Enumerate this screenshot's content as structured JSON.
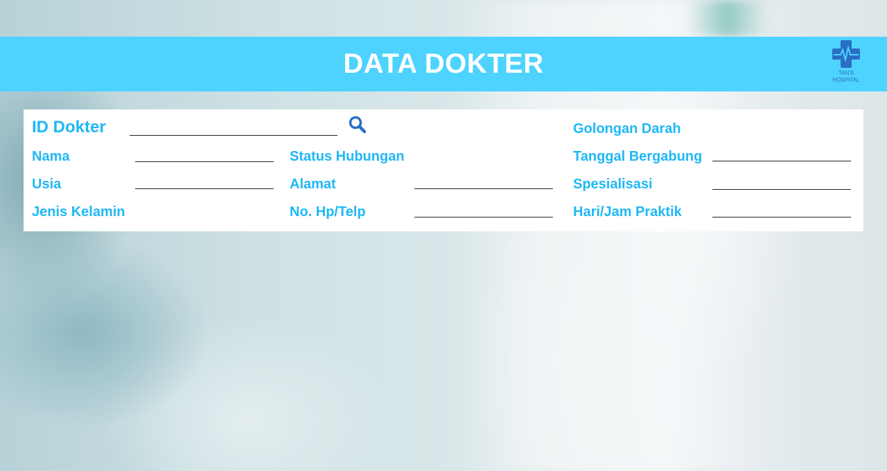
{
  "header": {
    "title": "DATA DOKTER",
    "logo_line1": "TAN'S",
    "logo_line2": "HOSPITAL",
    "bg_color": "#4dd3fe",
    "logo_color": "#2a6fc4"
  },
  "form": {
    "label_color": "#1fb8f5",
    "id_dokter": {
      "label": "ID Dokter",
      "value": ""
    },
    "nama": {
      "label": "Nama",
      "value": ""
    },
    "usia": {
      "label": "Usia",
      "value": ""
    },
    "jenis_kelamin": {
      "label": "Jenis Kelamin"
    },
    "status_hubungan": {
      "label": "Status Hubungan"
    },
    "alamat": {
      "label": "Alamat",
      "value": ""
    },
    "no_hp": {
      "label": "No. Hp/Telp",
      "value": ""
    },
    "golongan_darah": {
      "label": "Golongan Darah"
    },
    "tanggal_bergabung": {
      "label": "Tanggal Bergabung",
      "value": ""
    },
    "spesialisasi": {
      "label": "Spesialisasi",
      "value": ""
    },
    "hari_jam_praktik": {
      "label": "Hari/Jam Praktik",
      "value": ""
    },
    "search_icon": "search-icon"
  }
}
